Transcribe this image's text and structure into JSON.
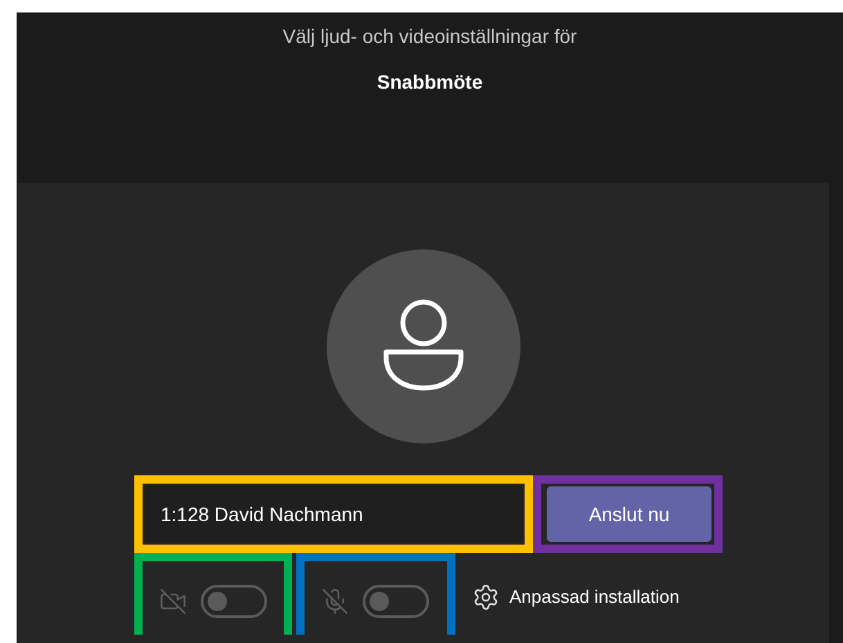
{
  "header": {
    "title": "Välj ljud- och videoinställningar för",
    "meeting_name": "Snabbmöte"
  },
  "name_field": {
    "value": "1:128 David Nachmann"
  },
  "join_button": {
    "label": "Anslut nu"
  },
  "camera_toggle": {
    "on": false
  },
  "microphone_toggle": {
    "on": false
  },
  "device_settings": {
    "label": "Anpassad installation"
  }
}
